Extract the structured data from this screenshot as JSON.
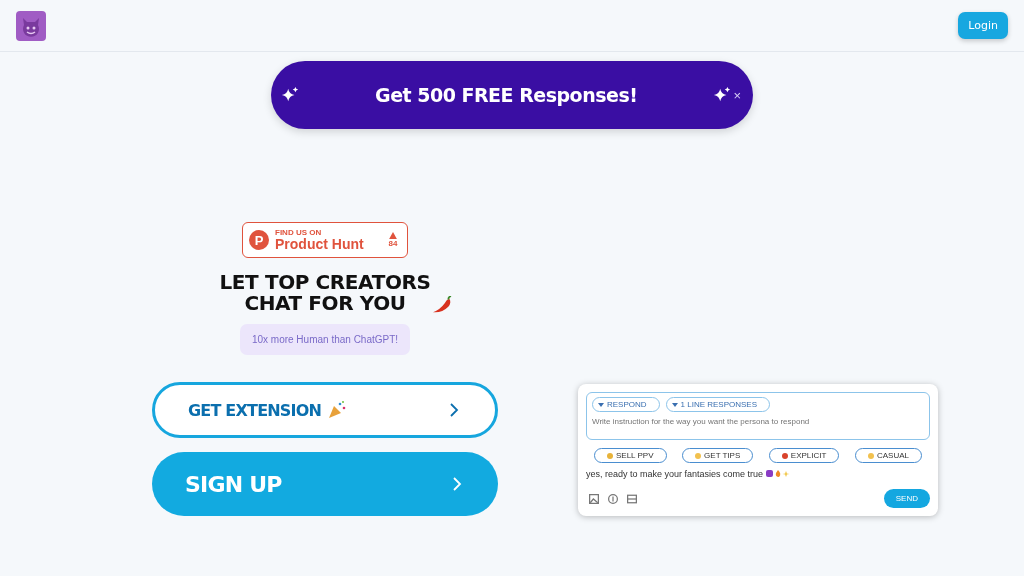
{
  "header": {
    "login_button": "Login"
  },
  "banner": {
    "text": "Get 500 FREE Responses!",
    "close": "×"
  },
  "product_hunt": {
    "logo_letter": "P",
    "eyebrow": "FIND US ON",
    "name": "Product Hunt",
    "votes": "84"
  },
  "headline": [
    "LET TOP CREATORS",
    "CHAT FOR YOU"
  ],
  "tagline": "10x more Human than ChatGPT!",
  "buttons": [
    {
      "label": "GET EXTENSION",
      "kind": "outline"
    },
    {
      "label": "SIGN UP",
      "kind": "filled"
    }
  ],
  "widget": {
    "dropdowns": [
      "RESPOND",
      "1 LINE RESPONSES"
    ],
    "placeholder": "Write instruction for the way you want the persona to respond",
    "presets": [
      "SELL PPV",
      "GET TIPS",
      "EXPLICIT",
      "CASUAL"
    ],
    "message": "yes, ready to make your fantasies come true",
    "send": "SEND"
  }
}
